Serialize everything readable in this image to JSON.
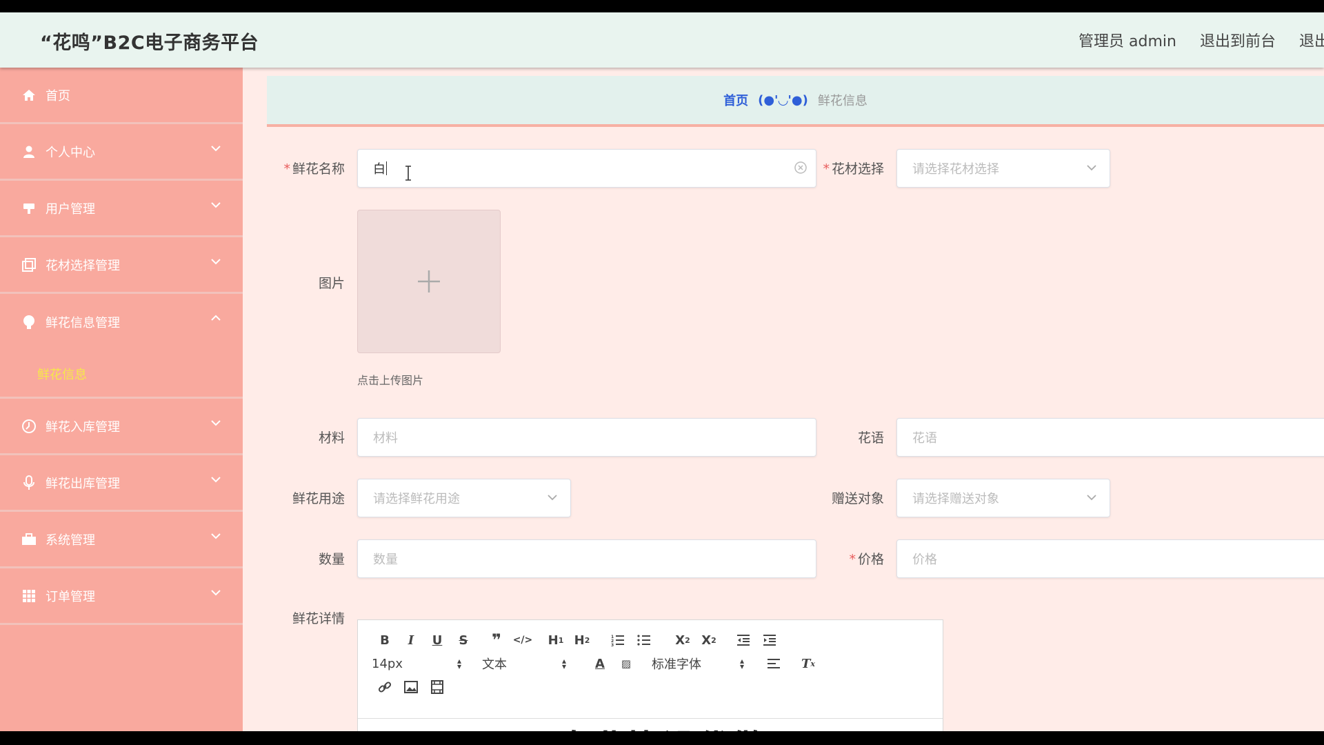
{
  "header": {
    "title": "“花鸣”B2C电子商务平台",
    "admin": "管理员 admin",
    "back_to_front": "退出到前台",
    "logout": "退出登录"
  },
  "sidebar": {
    "items": [
      {
        "label": "首页",
        "icon": "home-icon"
      },
      {
        "label": "个人中心",
        "icon": "person-icon"
      },
      {
        "label": "用户管理",
        "icon": "user-manage-icon"
      },
      {
        "label": "花材选择管理",
        "icon": "copy-icon"
      },
      {
        "label": "鲜花信息管理",
        "icon": "bulb-icon",
        "expanded": true,
        "sub": [
          "鲜花信息"
        ]
      },
      {
        "label": "鲜花入库管理",
        "icon": "clock-icon"
      },
      {
        "label": "鲜花出库管理",
        "icon": "mic-icon"
      },
      {
        "label": "系统管理",
        "icon": "briefcase-icon"
      },
      {
        "label": "订单管理",
        "icon": "grid-icon"
      }
    ]
  },
  "breadcrumb": {
    "home": "首页",
    "separator": "(●'◡'●)",
    "current": "鲜花信息"
  },
  "form": {
    "name_label": "鲜花名称",
    "name_value": "白",
    "material_select_label": "花材选择",
    "material_select_placeholder": "请选择花材选择",
    "image_label": "图片",
    "upload_hint": "点击上传图片",
    "material_label": "材料",
    "material_placeholder": "材料",
    "language_label": "花语",
    "language_placeholder": "花语",
    "usage_label": "鲜花用途",
    "usage_placeholder": "请选择鲜花用途",
    "recipient_label": "赠送对象",
    "recipient_placeholder": "请选择赠送对象",
    "quantity_label": "数量",
    "quantity_placeholder": "数量",
    "price_label": "价格",
    "price_placeholder": "价格",
    "detail_label": "鲜花详情"
  },
  "editor": {
    "font_size": "14px",
    "block_format": "文本",
    "font_family": "标准字体",
    "content": "专业毕设代做"
  },
  "colors": {
    "sidebar_bg": "#f9a99e",
    "active_sub": "#f6e84a",
    "crumb_link": "#2f5fd8",
    "required": "#e85c5c"
  }
}
